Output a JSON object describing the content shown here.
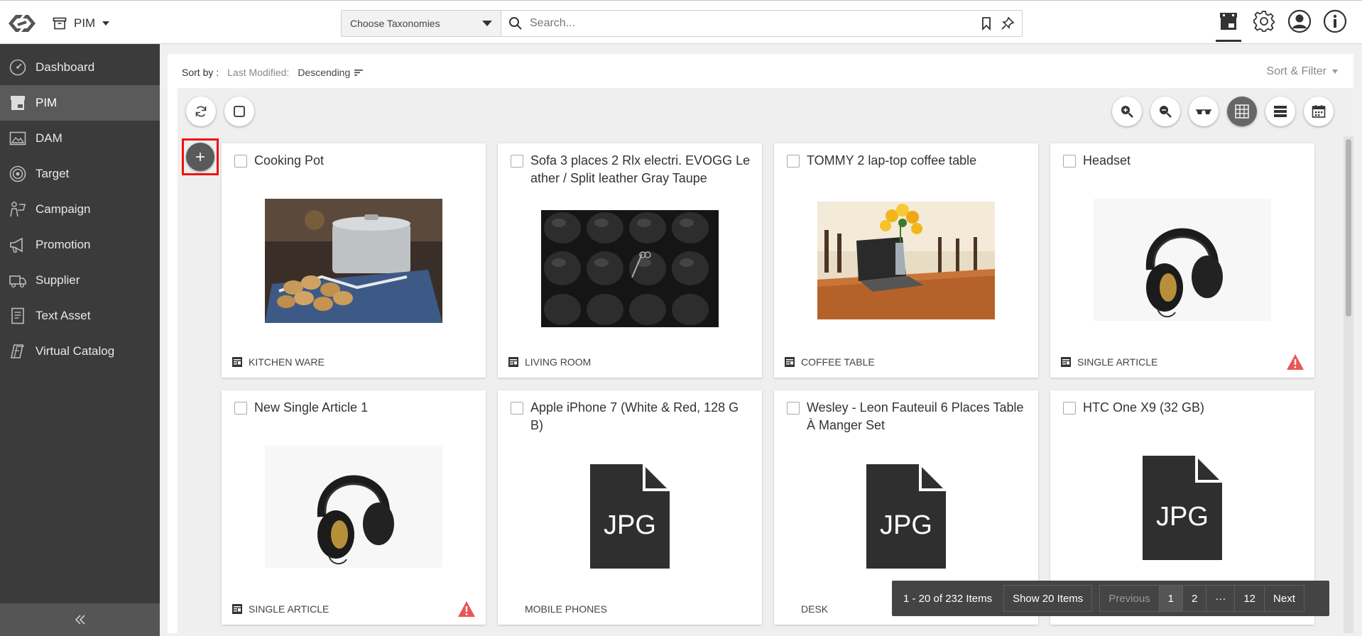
{
  "header": {
    "module": "PIM",
    "taxonomy_placeholder": "Choose Taxonomies",
    "search_placeholder": "Search..."
  },
  "sidebar": {
    "items": [
      {
        "label": "Dashboard",
        "icon": "dashboard-icon"
      },
      {
        "label": "PIM",
        "icon": "pim-icon",
        "active": true
      },
      {
        "label": "DAM",
        "icon": "dam-icon"
      },
      {
        "label": "Target",
        "icon": "target-icon"
      },
      {
        "label": "Campaign",
        "icon": "campaign-icon"
      },
      {
        "label": "Promotion",
        "icon": "promotion-icon"
      },
      {
        "label": "Supplier",
        "icon": "supplier-icon"
      },
      {
        "label": "Text Asset",
        "icon": "text-asset-icon"
      },
      {
        "label": "Virtual Catalog",
        "icon": "virtual-catalog-icon"
      }
    ]
  },
  "sort": {
    "label": "Sort by :",
    "field": "Last Modified:",
    "direction": "Descending",
    "filter_label": "Sort & Filter"
  },
  "cards": [
    {
      "title": "Cooking Pot",
      "category": "KITCHEN WARE"
    },
    {
      "title": "Sofa 3 places 2 Rlx electri. EVOGG Leather / Split leather Gray Taupe",
      "category": "LIVING ROOM"
    },
    {
      "title": "TOMMY 2 lap-top coffee table",
      "category": "COFFEE TABLE"
    },
    {
      "title": "Headset",
      "category": "SINGLE ARTICLE",
      "warning": true
    },
    {
      "title": "New Single Article 1",
      "category": "SINGLE ARTICLE",
      "warning": true
    },
    {
      "title": "Apple iPhone 7 (White & Red, 128 GB)",
      "category": "MOBILE PHONES",
      "placeholder": "JPG"
    },
    {
      "title": "Wesley - Leon Fauteuil 6 Places Table À Manger Set",
      "category": "DESK",
      "placeholder": "JPG"
    },
    {
      "title": "HTC One X9 (32 GB)",
      "category": "",
      "placeholder": "JPG"
    }
  ],
  "pager": {
    "count": "1 - 20 of 232 Items",
    "show": "Show 20 Items",
    "previous": "Previous",
    "pages": [
      "1",
      "2",
      "···",
      "12"
    ],
    "next": "Next"
  },
  "colors": {
    "sidebar_bg": "#3b3b3b",
    "sidebar_active": "#5a5a5a",
    "highlight": "#e11111",
    "warning": "#e85757",
    "pager_bg": "#444444"
  }
}
